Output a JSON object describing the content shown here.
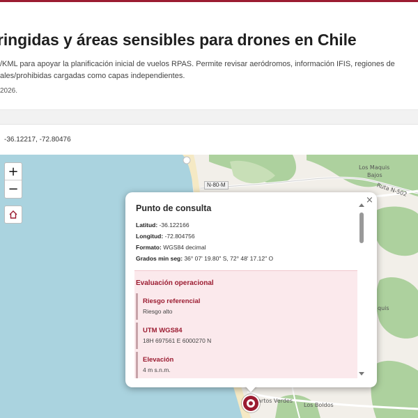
{
  "header": {
    "title": "ringidas y áreas sensibles para drones en Chile",
    "description_line1": "/KML para apoyar la planificación inicial de vuelos RPAS. Permite revisar aeródromos, información IFIS, regiones de",
    "description_line2": "ales/prohibidas cargadas como capas independientes.",
    "date_text": "2026."
  },
  "coords_readout": "-36.12217, -72.80476",
  "map": {
    "labels": {
      "los_maquis_1": "Los Maquis",
      "los_maquis_2": "Bajos",
      "ruta_n502": "Ruta N-502",
      "quis": "quis",
      "cuartos_verdes": "artos Verdes",
      "los_boldos": "Los Boldos"
    },
    "road_badge": "N-80-M",
    "zoom_in": "+",
    "zoom_out": "−",
    "close": "×"
  },
  "popup": {
    "title": "Punto de consulta",
    "lat_label": "Latitud:",
    "lat_value": "-36.122166",
    "lon_label": "Longitud:",
    "lon_value": "-72.804756",
    "format_label": "Formato:",
    "format_value": "WGS84 decimal",
    "dms_label": "Grados min seg:",
    "dms_value": "36° 07' 19.80\" S, 72° 48' 17.12\" O",
    "eval_title": "Evaluación operacional",
    "cards": [
      {
        "key": "Riesgo referencial",
        "value": "Riesgo alto"
      },
      {
        "key": "UTM WGS84",
        "value": "18H 697561 E 6000270 N"
      },
      {
        "key": "Elevación",
        "value": "4 m s.n.m."
      }
    ]
  },
  "colors": {
    "accent": "#9b1c31",
    "sea": "#aad3df",
    "land": "#f2efe9",
    "forest": "#add19e"
  },
  "icons": {
    "home": "home-icon",
    "marker": "location-marker-icon"
  }
}
